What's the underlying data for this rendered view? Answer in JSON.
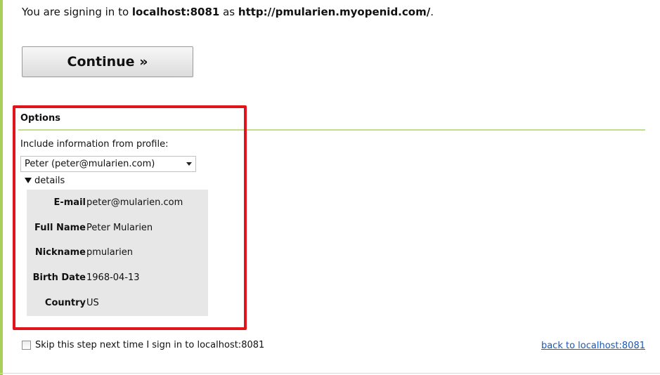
{
  "header": {
    "prefix": "You are signing in to ",
    "site": "localhost:8081",
    "middle": " as ",
    "identity": "http://pmularien.myopenid.com/",
    "suffix": "."
  },
  "continue_button": {
    "label": "Continue »"
  },
  "options": {
    "title": "Options",
    "include_label": "Include information from profile:",
    "profile_select": {
      "selected": "Peter (peter@mularien.com)",
      "icon": "chevron-down-icon"
    },
    "details_toggle": {
      "label": "details",
      "icon": "triangle-down-icon"
    },
    "details": [
      {
        "label": "E-mail",
        "value": "peter@mularien.com"
      },
      {
        "label": "Full Name",
        "value": "Peter Mularien"
      },
      {
        "label": "Nickname",
        "value": "pmularien"
      },
      {
        "label": "Birth Date",
        "value": "1968-04-13"
      },
      {
        "label": "Country",
        "value": "US"
      }
    ]
  },
  "footer": {
    "skip_label": "Skip this step next time I sign in to localhost:8081",
    "skip_checked": false,
    "back_link": "back to localhost:8081"
  },
  "colors": {
    "accent_green": "#a9cf5a",
    "rule_green": "#bfdf8a",
    "highlight_red": "#e0141a",
    "link_blue": "#1a58b8",
    "details_bg": "#e7e7e7"
  }
}
